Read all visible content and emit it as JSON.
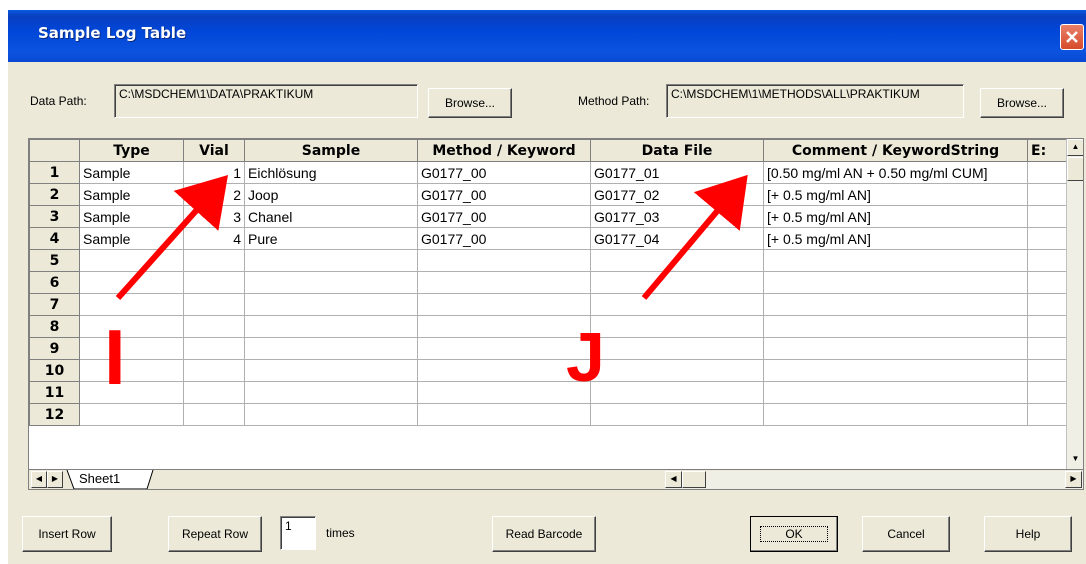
{
  "window": {
    "title": "Sample Log Table",
    "close_label": "close"
  },
  "paths": {
    "data_label": "Data Path:",
    "data_value": "C:\\MSDCHEM\\1\\DATA\\PRAKTIKUM",
    "method_label": "Method Path:",
    "method_value": "C:\\MSDCHEM\\1\\METHODS\\ALL\\PRAKTIKUM",
    "browse_label": "Browse..."
  },
  "grid": {
    "columns": [
      "Type",
      "Vial",
      "Sample",
      "Method / Keyword",
      "Data File",
      "Comment / KeywordString",
      "E:"
    ],
    "rows": [
      {
        "n": "1",
        "type": "Sample",
        "vial": "1",
        "sample": "Eichlösung",
        "method": "G0177_00",
        "file": "G0177_01",
        "comment": "[0.50 mg/ml AN + 0.50 mg/ml CUM]"
      },
      {
        "n": "2",
        "type": "Sample",
        "vial": "2",
        "sample": "Joop",
        "method": "G0177_00",
        "file": "G0177_02",
        "comment": "[+ 0.5 mg/ml AN]"
      },
      {
        "n": "3",
        "type": "Sample",
        "vial": "3",
        "sample": "Chanel",
        "method": "G0177_00",
        "file": "G0177_03",
        "comment": "[+ 0.5 mg/ml AN]"
      },
      {
        "n": "4",
        "type": "Sample",
        "vial": "4",
        "sample": "Pure",
        "method": "G0177_00",
        "file": "G0177_04",
        "comment": "[+ 0.5 mg/ml AN]"
      },
      {
        "n": "5",
        "type": "",
        "vial": "",
        "sample": "",
        "method": "",
        "file": "",
        "comment": ""
      },
      {
        "n": "6",
        "type": "",
        "vial": "",
        "sample": "",
        "method": "",
        "file": "",
        "comment": ""
      },
      {
        "n": "7",
        "type": "",
        "vial": "",
        "sample": "",
        "method": "",
        "file": "",
        "comment": ""
      },
      {
        "n": "8",
        "type": "",
        "vial": "",
        "sample": "",
        "method": "",
        "file": "",
        "comment": ""
      },
      {
        "n": "9",
        "type": "",
        "vial": "",
        "sample": "",
        "method": "",
        "file": "",
        "comment": ""
      },
      {
        "n": "10",
        "type": "",
        "vial": "",
        "sample": "",
        "method": "",
        "file": "",
        "comment": ""
      },
      {
        "n": "11",
        "type": "",
        "vial": "",
        "sample": "",
        "method": "",
        "file": "",
        "comment": ""
      },
      {
        "n": "12",
        "type": "",
        "vial": "",
        "sample": "",
        "method": "",
        "file": "",
        "comment": ""
      }
    ],
    "sheet_tab": "Sheet1"
  },
  "annotations": {
    "letter_i": "I",
    "letter_j": "J",
    "arrow_color": "#ff0000"
  },
  "buttons": {
    "insert_row": "Insert Row",
    "repeat_row": "Repeat Row",
    "repeat_times_value": "1",
    "times_label": "times",
    "read_barcode": "Read Barcode",
    "ok": "OK",
    "cancel": "Cancel",
    "help": "Help"
  }
}
